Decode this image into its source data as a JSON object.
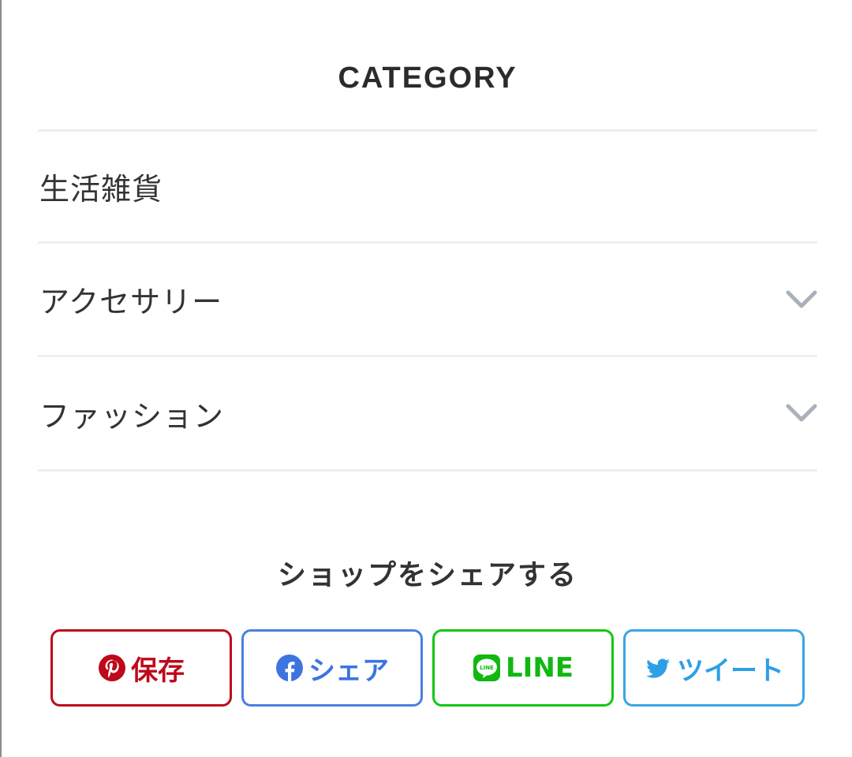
{
  "category": {
    "title": "CATEGORY",
    "items": [
      {
        "label": "生活雑貨",
        "expandable": false
      },
      {
        "label": "アクセサリー",
        "expandable": true
      },
      {
        "label": "ファッション",
        "expandable": true
      }
    ]
  },
  "share": {
    "title": "ショップをシェアする",
    "buttons": {
      "pinterest": {
        "label": "保存",
        "icon": "pinterest-icon",
        "color": "#bd0a1b"
      },
      "facebook": {
        "label": "シェア",
        "icon": "facebook-icon",
        "color": "#3c74e0"
      },
      "line": {
        "label": "LINE",
        "icon": "line-icon",
        "icon_text": "LINE",
        "color": "#10b810"
      },
      "twitter": {
        "label": "ツイート",
        "icon": "twitter-icon",
        "color": "#2e9fe6"
      }
    }
  },
  "colors": {
    "divider": "#eeeeee",
    "chevron": "#a9b1bb",
    "text": "#333333"
  }
}
